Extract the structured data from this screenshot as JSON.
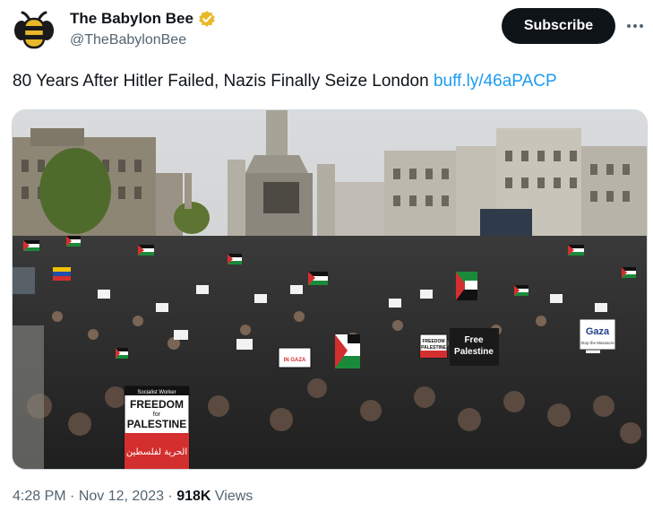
{
  "account": {
    "display_name": "The Babylon Bee",
    "handle": "@TheBabylonBee",
    "avatar_icon": "bee-logo-icon",
    "verified_icon": "verified-badge-icon",
    "verified_color": "#e8b829"
  },
  "actions": {
    "subscribe_label": "Subscribe",
    "more_icon": "more-options-icon"
  },
  "tweet": {
    "text": "80 Years After Hitler Failed, Nazis Finally Seize London ",
    "link_text": "buff.ly/46aPACP",
    "link_color": "#1d9bf0"
  },
  "media": {
    "description_icon": "protest-photo",
    "signs": [
      {
        "line1": "Socialist Worker",
        "line2": "FREEDOM",
        "line3": "for",
        "line4": "PALESTINE",
        "line5": "الحرية لفلسطين"
      },
      {
        "line1": "Free",
        "line2": "Palestine"
      },
      {
        "line1": "Gaza",
        "line2": "Stop the Massacre"
      },
      {
        "line1": "FREEDOM",
        "line2": "PALESTINE"
      },
      {
        "line1": "IN GAZA"
      }
    ]
  },
  "meta": {
    "time": "4:28 PM",
    "separator1": " · ",
    "date": "Nov 12, 2023",
    "separator2": " · ",
    "views_count": "918K",
    "views_label": " Views"
  }
}
